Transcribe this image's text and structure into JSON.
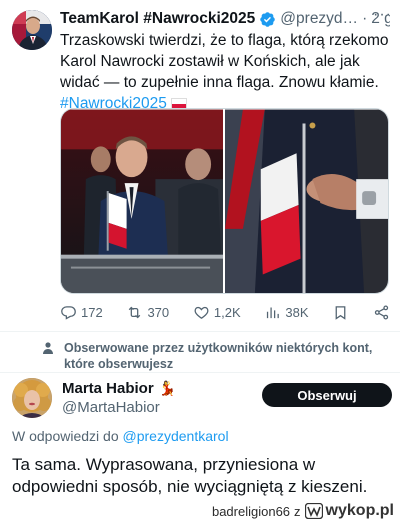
{
  "tweet": {
    "author": "TeamKarol #Nawrocki2025",
    "handle": "@prezyd…",
    "dot": "·",
    "time": "2 g.",
    "more": "···",
    "text": "Trzaskowski twierdzi, że to flaga, którą rzekomo Karol Nawrocki zostawił w Końskich, ale jak widać — to zupełnie inna flaga. Znowu kłamie.",
    "hashtag": "#Nawrocki2025",
    "stats": {
      "replies": "172",
      "reposts": "370",
      "likes": "1,2K",
      "views": "38K"
    }
  },
  "context": {
    "text": "Obserwowane przez użytkowników niektórych kont, które obserwujesz"
  },
  "reply": {
    "author": "Marta Habior",
    "emoji": "💃",
    "handle": "@MartaHabior",
    "follow_label": "Obserwuj",
    "in_reply_prefix": "W odpowiedzi do",
    "in_reply_handle": "@prezydentkarol",
    "text": "Ta sama. Wyprasowana, przyniesiona w odpowiedni sposób, nie wyciągniętą z kieszeni."
  },
  "watermark": {
    "user": "badreligion66",
    "by": "z",
    "site": "wykop.pl"
  },
  "colors": {
    "accent": "#1d9bf0",
    "text": "#0f1419",
    "muted": "#536471",
    "flag_red": "#dc143c"
  }
}
